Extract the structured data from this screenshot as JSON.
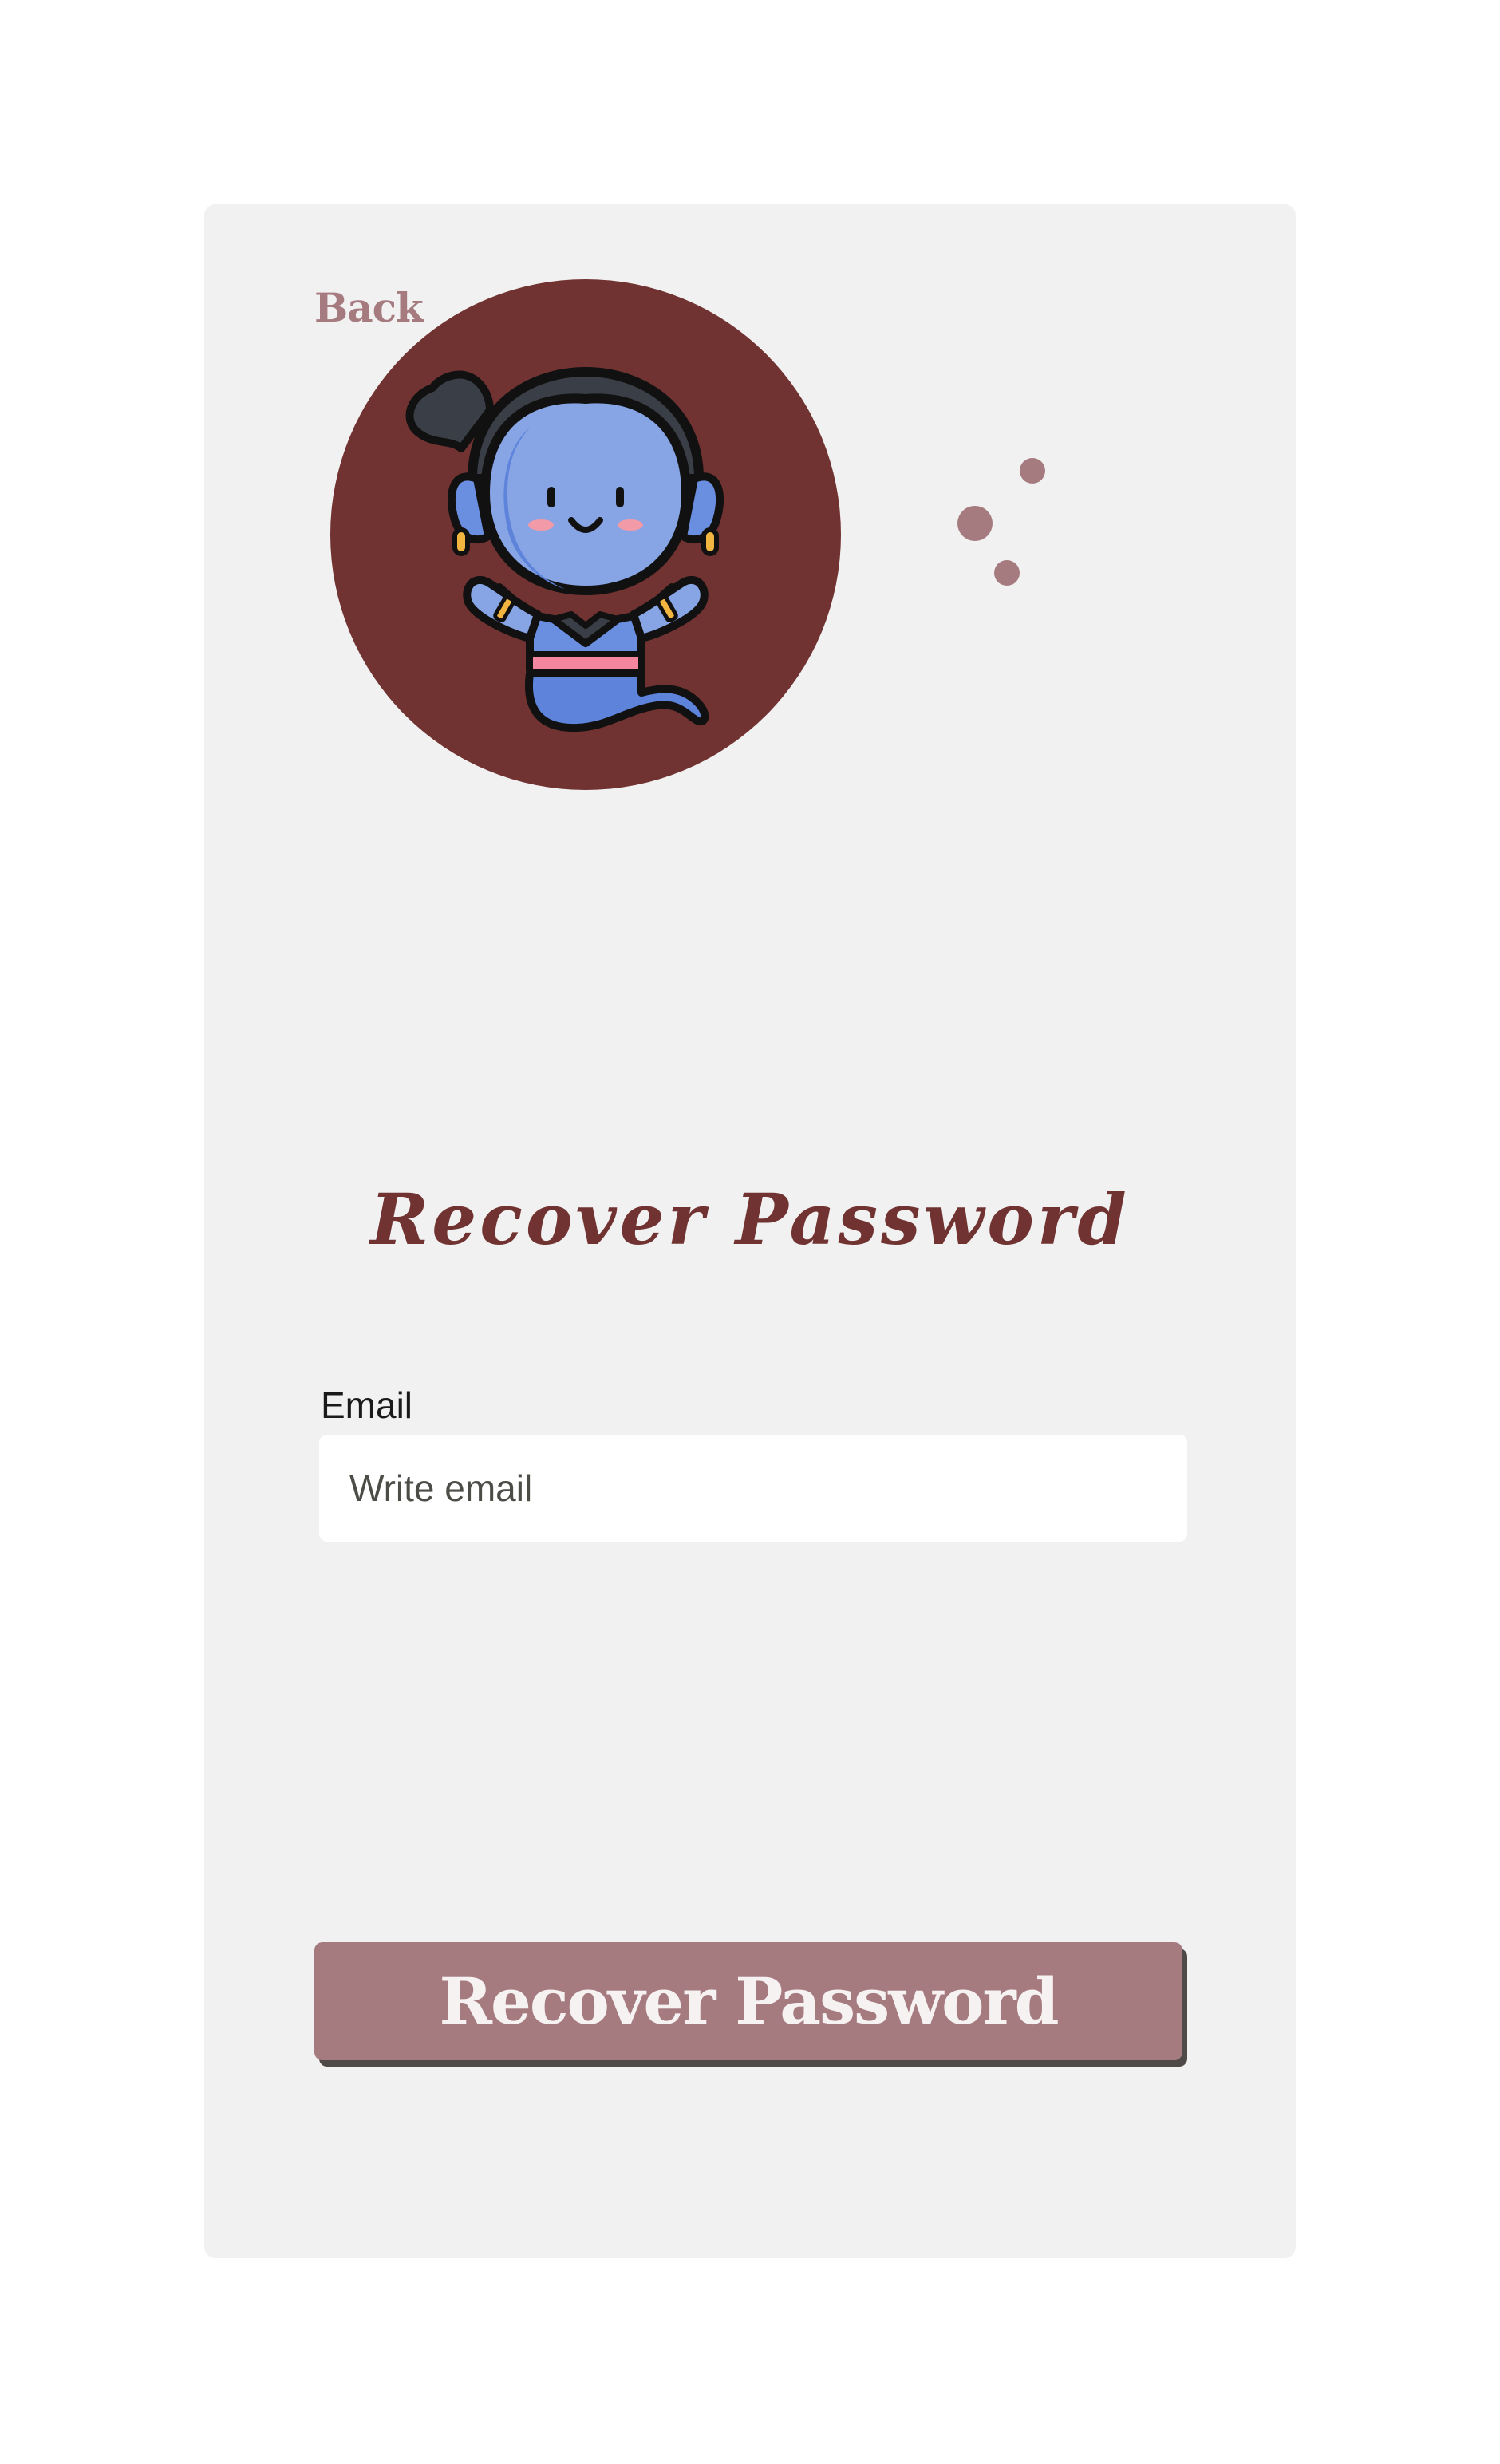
{
  "back": {
    "label": "Back"
  },
  "title": "Recover Password",
  "form": {
    "email_label": "Email",
    "email_placeholder": "Write email",
    "email_value": ""
  },
  "submit": {
    "label": "Recover Password"
  },
  "colors": {
    "card_bg": "#f1f1f1",
    "accent": "#a57b80",
    "avatar_bg": "#713331",
    "title": "#713331",
    "button_shadow": "#4f4a47"
  },
  "avatar": {
    "icon": "genie-icon"
  }
}
